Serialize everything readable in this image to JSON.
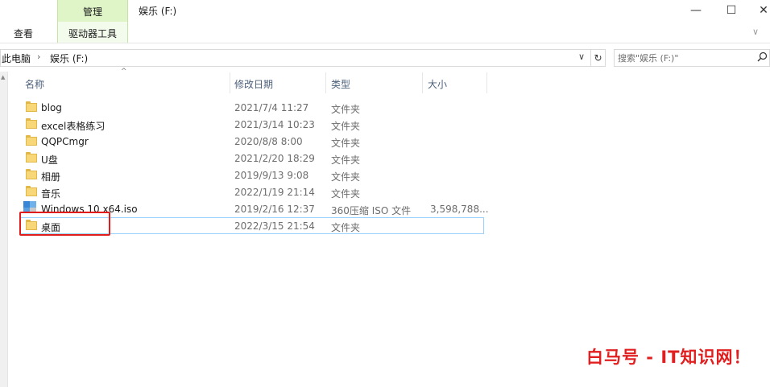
{
  "window": {
    "title": "娱乐 (F:)",
    "minimize_glyph": "—",
    "maximize_glyph": "☐",
    "close_glyph": "✕"
  },
  "ribbon": {
    "manage_label": "管理",
    "view_tab": "查看",
    "drive_tools_tab": "驱动器工具",
    "expand_glyph": "∨"
  },
  "address": {
    "root": "此电脑",
    "separator": "›",
    "current": "娱乐 (F:)",
    "dropdown_glyph": "∨",
    "refresh_glyph": "↻"
  },
  "search": {
    "placeholder": "搜索\"娱乐 (F:)\"",
    "icon": "search-icon"
  },
  "columns": {
    "name": "名称",
    "date": "修改日期",
    "type": "类型",
    "size": "大小",
    "sort_glyph": "^"
  },
  "files": [
    {
      "name": "blog",
      "date": "2021/7/4 11:27",
      "type": "文件夹",
      "size": "",
      "icon": "folder-icon"
    },
    {
      "name": "excel表格练习",
      "date": "2021/3/14 10:23",
      "type": "文件夹",
      "size": "",
      "icon": "folder-icon"
    },
    {
      "name": "QQPCmgr",
      "date": "2020/8/8 8:00",
      "type": "文件夹",
      "size": "",
      "icon": "folder-icon"
    },
    {
      "name": "U盘",
      "date": "2021/2/20 18:29",
      "type": "文件夹",
      "size": "",
      "icon": "folder-icon"
    },
    {
      "name": "相册",
      "date": "2019/9/13 9:08",
      "type": "文件夹",
      "size": "",
      "icon": "folder-icon"
    },
    {
      "name": "音乐",
      "date": "2022/1/19 21:14",
      "type": "文件夹",
      "size": "",
      "icon": "folder-icon"
    },
    {
      "name": "Windows 10 x64.iso",
      "date": "2019/2/16 12:37",
      "type": "360压缩 ISO 文件",
      "size": "3,598,788...",
      "icon": "iso-file-icon"
    },
    {
      "name": "桌面",
      "date": "2022/3/15 21:54",
      "type": "文件夹",
      "size": "",
      "icon": "folder-icon",
      "selected": true
    }
  ],
  "watermark": "白马号 - IT知识网！",
  "colors": {
    "manage_tab": "#dff5c8",
    "selection_border": "#99d1ff",
    "highlight_box": "#e21b1b",
    "watermark": "#e02020",
    "folder": "#f7d777"
  }
}
